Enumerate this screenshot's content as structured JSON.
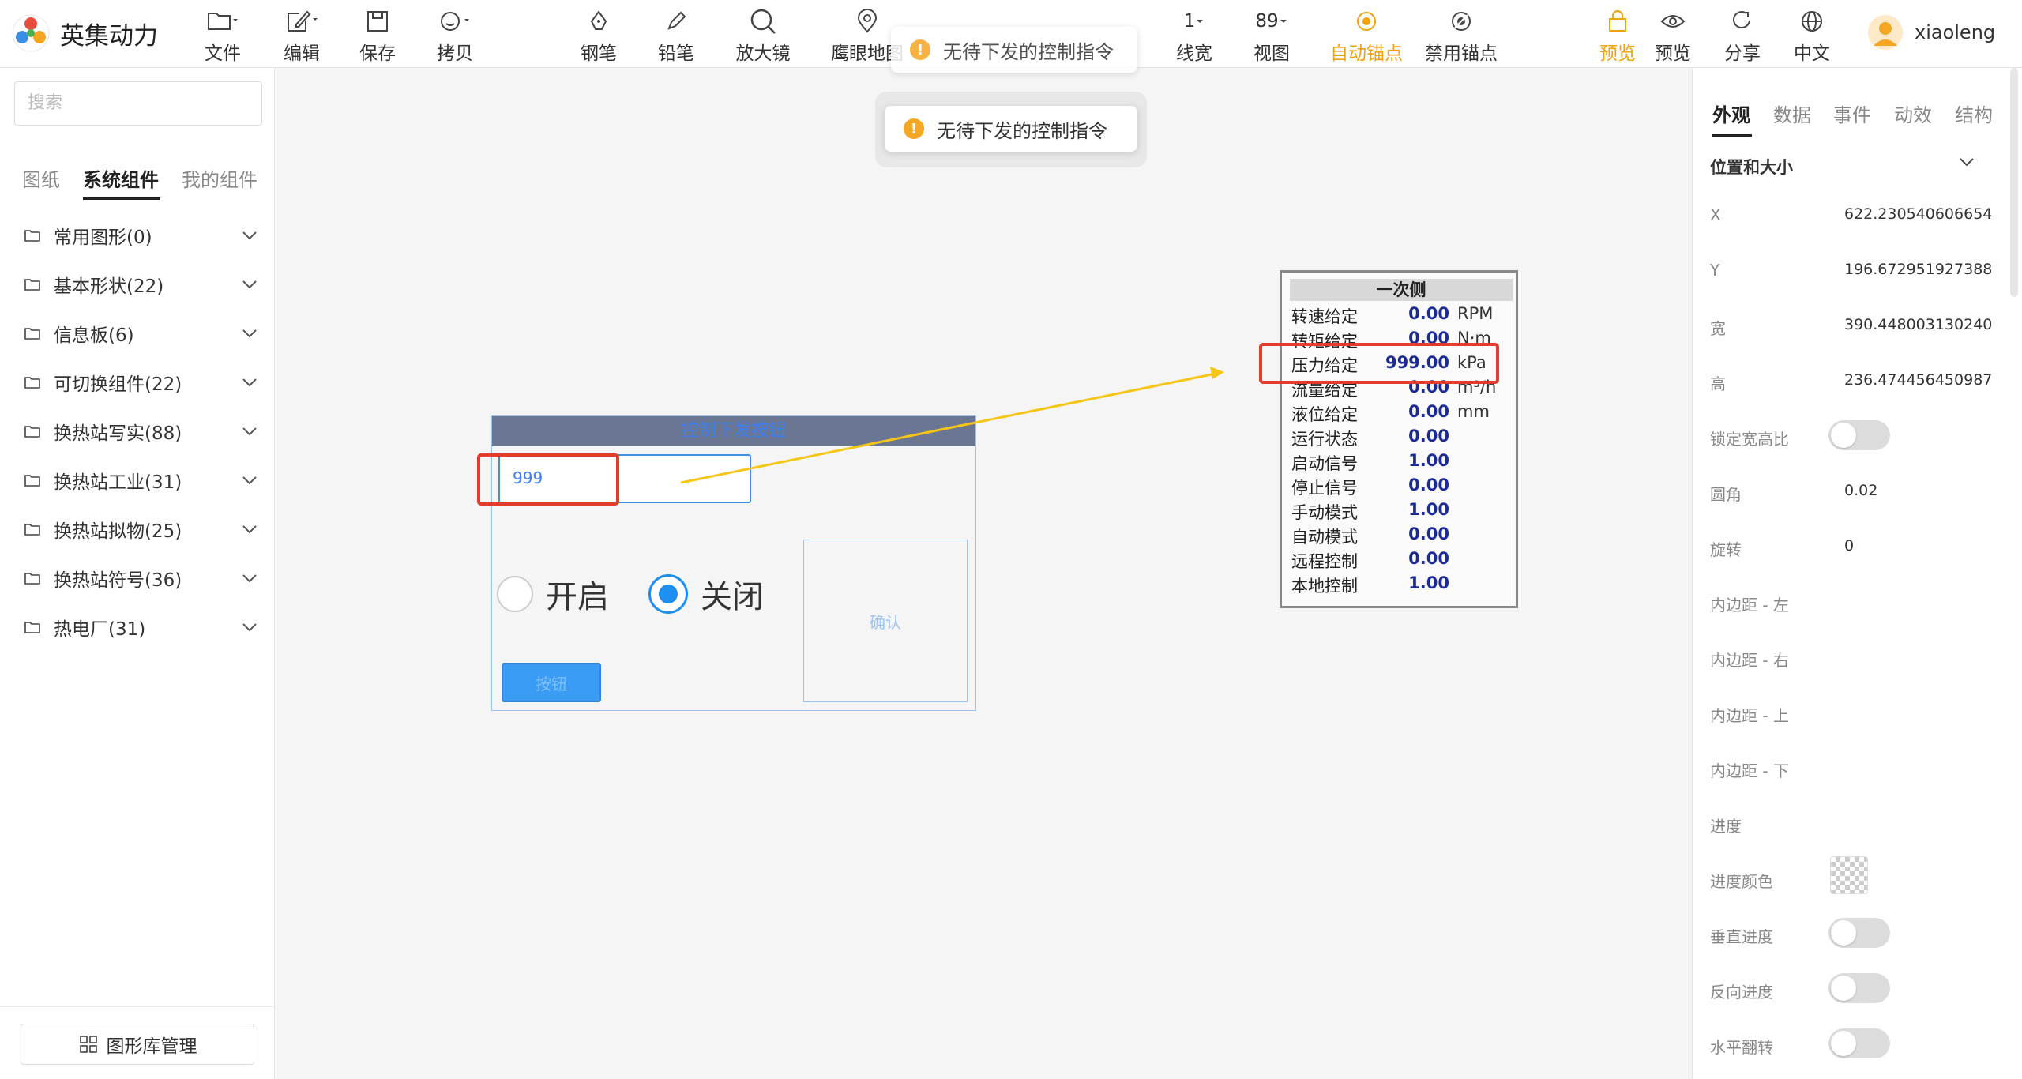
{
  "app": {
    "title": "英集动力"
  },
  "toolbar": {
    "left": [
      {
        "label": "文件",
        "icon": "folder-icon"
      },
      {
        "label": "编辑",
        "icon": "edit-icon"
      },
      {
        "label": "保存",
        "icon": "save-icon"
      },
      {
        "label": "拷贝",
        "icon": "copy-icon"
      }
    ],
    "center": [
      {
        "label": "钢笔",
        "icon": "pen-icon"
      },
      {
        "label": "铅笔",
        "icon": "pencil-icon"
      },
      {
        "label": "放大镜",
        "icon": "magnifier-icon"
      },
      {
        "label": "鹰眼地图",
        "icon": "location-icon"
      }
    ],
    "line_width": {
      "value": "1",
      "label": "线宽"
    },
    "view": {
      "value": "89",
      "label": "视图"
    },
    "auto_anchor": {
      "label": "自动锚点",
      "color": "#f2a20d"
    },
    "disable_anchor": {
      "label": "禁用锚点"
    },
    "right": [
      {
        "label": "预览",
        "icon": "lock-icon",
        "color": "#f2a20d"
      },
      {
        "label": "预览",
        "icon": "eye-icon"
      },
      {
        "label": "分享",
        "icon": "share-icon"
      },
      {
        "label": "中文",
        "icon": "globe-icon"
      }
    ],
    "user": {
      "name": "xiaoleng"
    }
  },
  "toasts": [
    {
      "text": "无待下发的控制指令"
    },
    {
      "text": "无待下发的控制指令"
    }
  ],
  "left_panel": {
    "search_placeholder": "搜索",
    "tabs": [
      "图纸",
      "系统组件",
      "我的组件"
    ],
    "active_tab": "系统组件",
    "categories": [
      "常用图形(0)",
      "基本形状(22)",
      "信息板(6)",
      "可切换组件(22)",
      "换热站写实(88)",
      "换热站工业(31)",
      "换热站拟物(25)",
      "换热站符号(36)",
      "热电厂(31)"
    ],
    "library_button": "图形库管理"
  },
  "canvas": {
    "widget": {
      "header": "控制下发按钮",
      "input_value": "999",
      "radio_open": "开启",
      "radio_close": "关闭",
      "selected": "关闭",
      "confirm": "确认",
      "button": "按钮"
    },
    "info_panel": {
      "title": "一次侧",
      "rows": [
        {
          "key": "转速给定",
          "value": "0.00",
          "unit": "RPM"
        },
        {
          "key": "转矩给定",
          "value": "0.00",
          "unit": "N·m"
        },
        {
          "key": "压力给定",
          "value": "999.00",
          "unit": "kPa"
        },
        {
          "key": "流量给定",
          "value": "0.00",
          "unit": "m³/h"
        },
        {
          "key": "液位给定",
          "value": "0.00",
          "unit": "mm"
        },
        {
          "key": "运行状态",
          "value": "0.00",
          "unit": ""
        },
        {
          "key": "启动信号",
          "value": "1.00",
          "unit": ""
        },
        {
          "key": "停止信号",
          "value": "0.00",
          "unit": ""
        },
        {
          "key": "手动模式",
          "value": "1.00",
          "unit": ""
        },
        {
          "key": "自动模式",
          "value": "0.00",
          "unit": ""
        },
        {
          "key": "远程控制",
          "value": "0.00",
          "unit": ""
        },
        {
          "key": "本地控制",
          "value": "1.00",
          "unit": ""
        }
      ]
    },
    "highlight_color": "#e23c2b",
    "arrow_color": "#f5c518"
  },
  "right_panel": {
    "tabs": [
      "外观",
      "数据",
      "事件",
      "动效",
      "结构"
    ],
    "active_tab": "外观",
    "section": "位置和大小",
    "props": [
      {
        "label": "X",
        "value": "622.230540606654"
      },
      {
        "label": "Y",
        "value": "196.672951927388"
      },
      {
        "label": "宽",
        "value": "390.448003130240"
      },
      {
        "label": "高",
        "value": "236.474456450987"
      },
      {
        "label": "锁定宽高比",
        "value": ""
      },
      {
        "label": "圆角",
        "value": "0.02"
      },
      {
        "label": "旋转",
        "value": "0"
      },
      {
        "label": "内边距 - 左",
        "value": ""
      },
      {
        "label": "内边距 - 右",
        "value": ""
      },
      {
        "label": "内边距 - 上",
        "value": ""
      },
      {
        "label": "内边距 - 下",
        "value": ""
      },
      {
        "label": "进度",
        "value": ""
      },
      {
        "label": "进度颜色",
        "value": ""
      },
      {
        "label": "垂直进度",
        "value": ""
      },
      {
        "label": "反向进度",
        "value": ""
      },
      {
        "label": "水平翻转",
        "value": ""
      }
    ]
  }
}
